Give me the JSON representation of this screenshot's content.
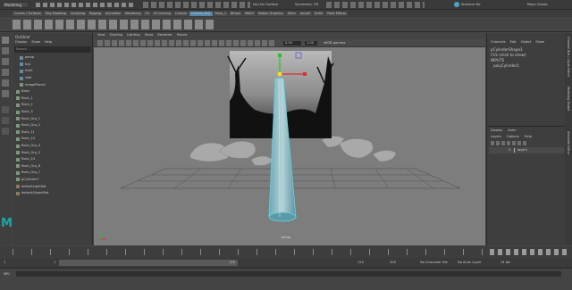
{
  "topbar": {
    "workspace": "Modeling",
    "live_surface": "No Live Surface",
    "symmetry": "Symmetry: Off",
    "user": "Shannon Ro",
    "maya_classic": "Maya Classic"
  },
  "shelf_tabs": [
    "Curves / Surfaces",
    "Poly Modeling",
    "Sculpting",
    "Rigging",
    "Animation",
    "Rendering",
    "FX",
    "FX Caching",
    "Custom",
    "Custom_Poly",
    "Polys_1",
    "Bifrost",
    "MASH",
    "Motion Graphics",
    "XGen",
    "Arnold",
    "Turtle",
    "Paint Effects"
  ],
  "outliner": {
    "title": "Outliner",
    "menus": [
      "Display",
      "Show",
      "Help"
    ],
    "search_placeholder": "Search...",
    "items": [
      "persp",
      "top",
      "front",
      "side",
      "imagePlane1",
      "Base",
      "Rock_1",
      "Rock_2",
      "Rock_3",
      "Rock_Grp_1",
      "Rock_Grp_2",
      "Rock_11",
      "Rock_14",
      "Rock_Grp_4",
      "Rock_Grp_5",
      "Rock_24",
      "Rock_Grp_6",
      "Rock_Grp_7",
      "pCylinder1",
      "defaultLightSet",
      "defaultObjectSet"
    ]
  },
  "viewport": {
    "menus": [
      "View",
      "Shading",
      "Lighting",
      "Show",
      "Renderer",
      "Panels"
    ],
    "field_a": "0.00",
    "field_b": "1.00",
    "colorspace": "sRGB gamma",
    "camera_label": "persp"
  },
  "channel_box": {
    "tabs": [
      "Channels",
      "Edit",
      "Object",
      "Show"
    ],
    "shape_name": "pCylinderShape1",
    "click_hint": "CVs (click to show)",
    "inputs_label": "INPUTS",
    "input_node": "polyCylinder1"
  },
  "layer_editor": {
    "tabs": [
      "Display",
      "Anim"
    ],
    "menus": [
      "Layers",
      "Options",
      "Help"
    ],
    "layer_visibility": "V",
    "layer_name": "layer1"
  },
  "side_tabs": [
    "Channel Box / Layer Editor",
    "Modeling Toolkit",
    "Attribute Editor"
  ],
  "timeline": {
    "current_frame_left": "1",
    "range_start": "1",
    "range_end": "120",
    "end_frame": "120",
    "max_frame": "200",
    "character_set": "No Character Set",
    "anim_layer": "No Anim Layer",
    "fps": "24 fps"
  },
  "status": {
    "mel_label": "MEL"
  },
  "colors": {
    "panel_bg": "#444444",
    "viewport_bg": "#7d7d7d",
    "selection_cyan": "#5fd7e6",
    "maya_logo": "#1aa7a9",
    "active_tab": "#5285a6"
  }
}
